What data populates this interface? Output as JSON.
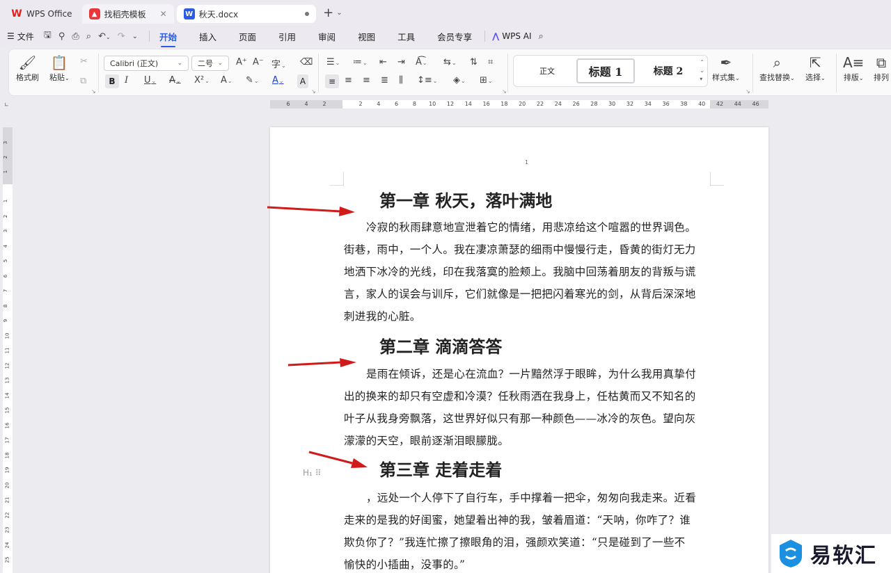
{
  "tabs": [
    {
      "label": "WPS Office",
      "icon": "wps-logo-icon"
    },
    {
      "label": "找稻壳模板",
      "icon": "docer-logo-icon"
    },
    {
      "label": "秋天.docx",
      "icon": "word-doc-icon"
    }
  ],
  "menu": {
    "file": "文件",
    "items": [
      "开始",
      "插入",
      "页面",
      "引用",
      "审阅",
      "视图",
      "工具",
      "会员专享"
    ],
    "active": "开始",
    "ai": "WPS AI"
  },
  "ribbon": {
    "format_painter": "格式刷",
    "paste": "粘贴",
    "font_name": "Calibri (正文)",
    "font_size": "二号",
    "styles": [
      "正文",
      "标题 1",
      "标题 2"
    ],
    "style_set": "样式集",
    "find_replace": "查找替换",
    "select": "选择",
    "layout": "排版",
    "arrange": "排列"
  },
  "ruler": {
    "h": [
      "6",
      "4",
      "2",
      "2",
      "4",
      "6",
      "8",
      "10",
      "12",
      "14",
      "16",
      "18",
      "20",
      "22",
      "24",
      "26",
      "28",
      "30",
      "32",
      "34",
      "36",
      "38",
      "40",
      "42",
      "44",
      "46"
    ],
    "v": [
      "3",
      "2",
      "1",
      "1",
      "2",
      "3",
      "4",
      "5",
      "6",
      "7",
      "8",
      "9",
      "10",
      "11",
      "12",
      "13",
      "14",
      "15",
      "16",
      "17",
      "18",
      "19",
      "20",
      "21",
      "22",
      "23",
      "24",
      "25"
    ]
  },
  "page_number": "1",
  "document": {
    "chapters": [
      {
        "title": "第一章  秋天，落叶满地",
        "lines": [
          "冷寂的秋雨肆意地宣泄着它的情绪，用悲凉给这个喧嚣的世界调色。",
          "街巷，雨中，一个人。我在凄凉萧瑟的细雨中慢慢行走，昏黄的街灯无力",
          "地洒下冰冷的光线，印在我落寞的脸颊上。我脑中回荡着朋友的背叛与谎",
          "言，家人的误会与训斥，它们就像是一把把闪着寒光的剑，从背后深深地",
          "刺进我的心脏。"
        ]
      },
      {
        "title": "第二章  滴滴答答",
        "lines": [
          "是雨在倾诉，还是心在流血？一片黯然浮于眼眸，为什么我用真挚付",
          "出的换来的却只有空虚和冷漠？任秋雨洒在我身上，任枯黄而又不知名的",
          "叶子从我身旁飘落，这世界好似只有那一种颜色——冰冷的灰色。望向灰",
          "濛濛的天空，眼前逐渐泪眼朦胧。"
        ]
      },
      {
        "title": "第三章  走着走着",
        "lines": [
          "，远处一个人停下了自行车，手中撑着一把伞，匆匆向我走来。近看",
          "走来的是我的好闺蜜，她望着出神的我，皱着眉道：“天呐，你咋了？谁",
          "欺负你了？”我连忙擦了擦眼角的泪，强颜欢笑道：“只是碰到了一些不",
          "愉快的小插曲，没事的。”"
        ]
      }
    ]
  },
  "heading_hint": "H₁",
  "watermark": "易软汇",
  "colors": {
    "accent": "#2b5ce6",
    "arrow": "#d11a1a"
  }
}
